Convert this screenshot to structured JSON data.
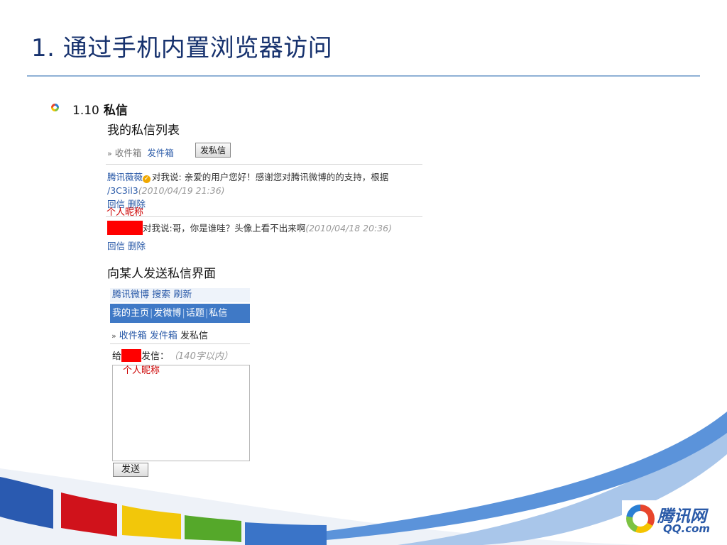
{
  "slide": {
    "title": "1. 通过手机内置浏览器访问",
    "section_number": "1.10",
    "section_title": "私信",
    "caption_list": "我的私信列表",
    "caption_send": "向某人发送私信界面"
  },
  "screenshot1": {
    "tab_inbox": "收件箱",
    "tab_outbox": "发件箱",
    "compose_button": "发私信",
    "msg1": {
      "sender": "腾讯薇薇",
      "text": "对我说: 亲爱的用户您好！感谢您对腾讯微博的的支持，根据",
      "link": "/3C3il3",
      "time": "(2010/04/19 21:36)",
      "reply": "回信",
      "delete": "删除"
    },
    "annotation": "个人昵称",
    "msg2": {
      "text": "对我说:哥，你是谁哇？头像上看不出来啊",
      "time": "(2010/04/18 20:36)",
      "reply": "回信",
      "delete": "删除"
    }
  },
  "screenshot2": {
    "nav": [
      "腾讯微博",
      "搜索",
      "刷新"
    ],
    "bar": [
      "我的主页",
      "发微博",
      "话题",
      "私信"
    ],
    "tab_inbox": "收件箱",
    "tab_outbox": "发件箱",
    "tab_compose": "发私信",
    "compose_prefix": "给",
    "compose_suffix": "发信：",
    "compose_hint": "（140字以内）",
    "annotation": "个人昵称",
    "send_button": "发送"
  },
  "logo": {
    "cn": "腾讯网",
    "en": "QQ.com"
  },
  "colors": {
    "title": "#17326e",
    "link": "#2a5aa8",
    "bar": "#3f79c6",
    "annotation": "#cc0000"
  }
}
